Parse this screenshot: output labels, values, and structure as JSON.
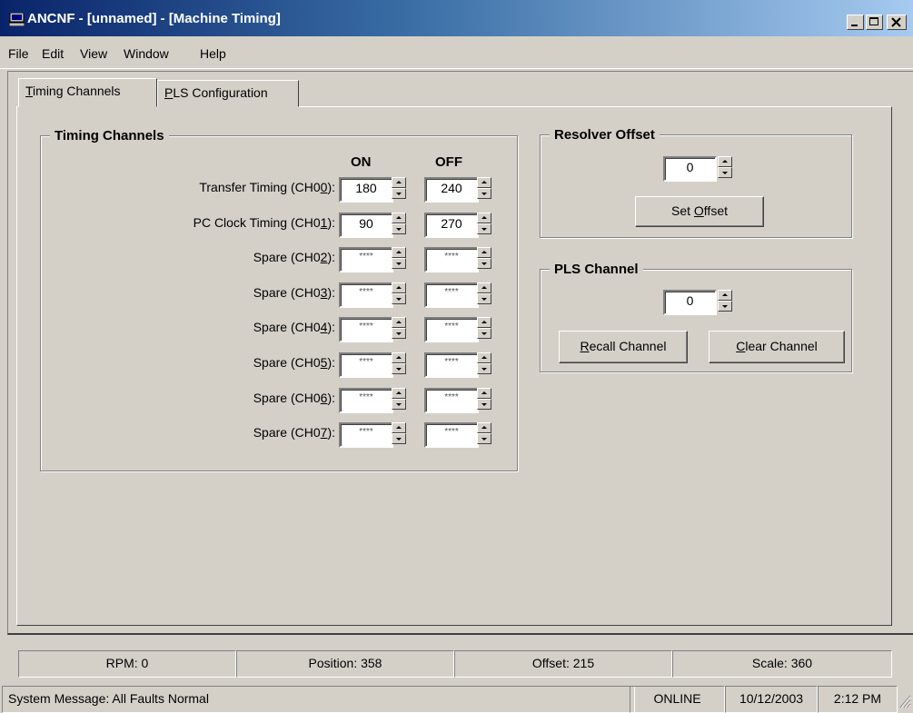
{
  "window": {
    "title": "ANCNF - [unnamed] - [Machine Timing]",
    "icon": "terminal-icon"
  },
  "menu": [
    "File",
    "Edit",
    "View",
    "Window",
    "Help"
  ],
  "tabs": {
    "timing": {
      "first": "T",
      "rest": "iming Channels"
    },
    "pls": {
      "first": "P",
      "rest": "LS Configuration"
    }
  },
  "timing_group": {
    "title": "Timing Channels",
    "col_on": "ON",
    "col_off": "OFF",
    "rows": [
      {
        "pre": "Transfer Timing (CH0",
        "key": "0",
        "post": "):",
        "on": "180",
        "off": "240"
      },
      {
        "pre": "PC Clock Timing (CH0",
        "key": "1",
        "post": "):",
        "on": "90",
        "off": "270"
      },
      {
        "pre": "Spare (CH0",
        "key": "2",
        "post": "):",
        "on": "****",
        "off": "****"
      },
      {
        "pre": "Spare (CH0",
        "key": "3",
        "post": "):",
        "on": "****",
        "off": "****"
      },
      {
        "pre": "Spare (CH0",
        "key": "4",
        "post": "):",
        "on": "****",
        "off": "****"
      },
      {
        "pre": "Spare (CH0",
        "key": "5",
        "post": "):",
        "on": "****",
        "off": "****"
      },
      {
        "pre": "Spare (CH0",
        "key": "6",
        "post": "):",
        "on": "****",
        "off": "****"
      },
      {
        "pre": "Spare (CH0",
        "key": "7",
        "post": "):",
        "on": "****",
        "off": "****"
      }
    ]
  },
  "resolver": {
    "title": "Resolver Offset",
    "value": "0",
    "set_pre": "Set ",
    "set_key": "O",
    "set_post": "ffset"
  },
  "pls_channel": {
    "title": "PLS Channel",
    "value": "0",
    "recall_key": "R",
    "recall_post": "ecall Channel",
    "clear_key": "C",
    "clear_post": "lear Channel"
  },
  "status": {
    "rpm": "RPM: 0",
    "position": "Position:  358",
    "offset": "Offset:  215",
    "scale": "Scale:  360"
  },
  "statusbar": {
    "message": "System Message:  All Faults Normal",
    "mode": "ONLINE",
    "date": "10/12/2003",
    "time": "2:12 PM"
  }
}
